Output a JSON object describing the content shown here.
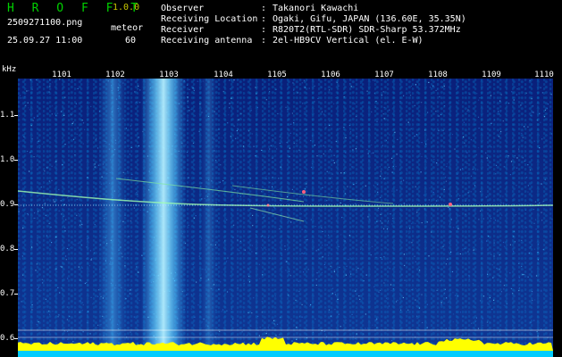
{
  "header": {
    "app_title": "H R O F F T",
    "app_version": "1.0.0",
    "filename": "2509271100.png",
    "mode": "meteor",
    "timestamp": "25.09.27 11:00",
    "count": "60",
    "info": [
      {
        "label": "Observer",
        "value": "Takanori Kawachi"
      },
      {
        "label": "Receiving Location",
        "value": "Ogaki, Gifu, JAPAN (136.60E, 35.35N)"
      },
      {
        "label": "Receiver",
        "value": "R820T2(RTL-SDR) SDR-Sharp 53.372MHz"
      },
      {
        "label": "Receiving antenna",
        "value": "2el-HB9CV Vertical (el. E-W)"
      }
    ]
  },
  "axis": {
    "unit": "kHz",
    "time_labels": [
      "1101",
      "1102",
      "1103",
      "1104",
      "1105",
      "1106",
      "1107",
      "1108",
      "1109",
      "1110"
    ],
    "freq_labels": [
      "1.1",
      "1.0",
      "0.9",
      "0.8",
      "0.7",
      "0.6"
    ],
    "freq_values": [
      1.1,
      1.0,
      0.9,
      0.8,
      0.7,
      0.6
    ]
  },
  "colors": {
    "background": "#0a1f7a",
    "noise": "#1a66c8",
    "signal": "#ffff00",
    "title": "#00d000",
    "text": "#ffffff",
    "baseline": "#ffff00",
    "bottom_band": "#00ccff"
  }
}
